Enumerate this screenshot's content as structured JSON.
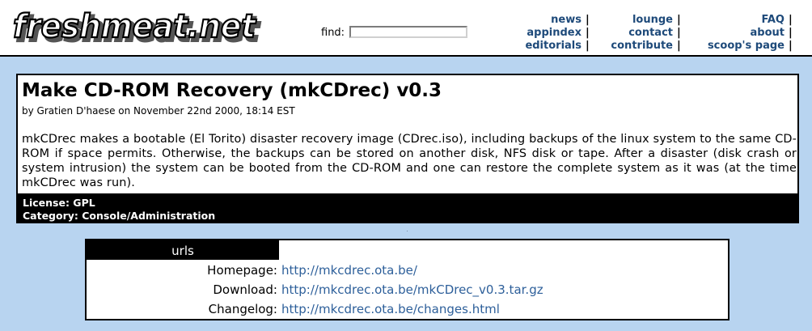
{
  "header": {
    "logo_text": "freshmeat.net",
    "find_label": "find:",
    "find_value": "",
    "nav_columns": [
      [
        "news",
        "appindex",
        "editorials"
      ],
      [
        "lounge",
        "contact",
        "contribute"
      ],
      [
        "FAQ",
        "about",
        "scoop's page"
      ]
    ],
    "separator": "|"
  },
  "article": {
    "title": "Make CD-ROM Recovery (mkCDrec) v0.3",
    "byline": "by Gratien D'haese on November 22nd 2000, 18:14 EST",
    "description": "mkCDrec makes a bootable (El Torito) disaster recovery image (CDrec.iso), including backups of the linux system to the same CD-ROM if space permits. Otherwise, the backups can be stored on another disk, NFS disk or tape. After a disaster (disk crash or system intrusion) the system can be booted from the CD-ROM and one can restore the complete system as it was (at the time mkCDrec was run).",
    "license": "License: GPL",
    "category": "Category: Console/Administration"
  },
  "urls": {
    "heading": "urls",
    "rows": [
      {
        "label": "Homepage:",
        "url": "http://mkcdrec.ota.be/"
      },
      {
        "label": "Download:",
        "url": "http://mkcdrec.ota.be/mkCDrec_v0.3.tar.gz"
      },
      {
        "label": "Changelog:",
        "url": "http://mkcdrec.ota.be/changes.html"
      }
    ]
  },
  "colors": {
    "page_background": "#b8d4f0",
    "nav_link": "#1e4a7a",
    "url_link": "#2d5f9a"
  }
}
